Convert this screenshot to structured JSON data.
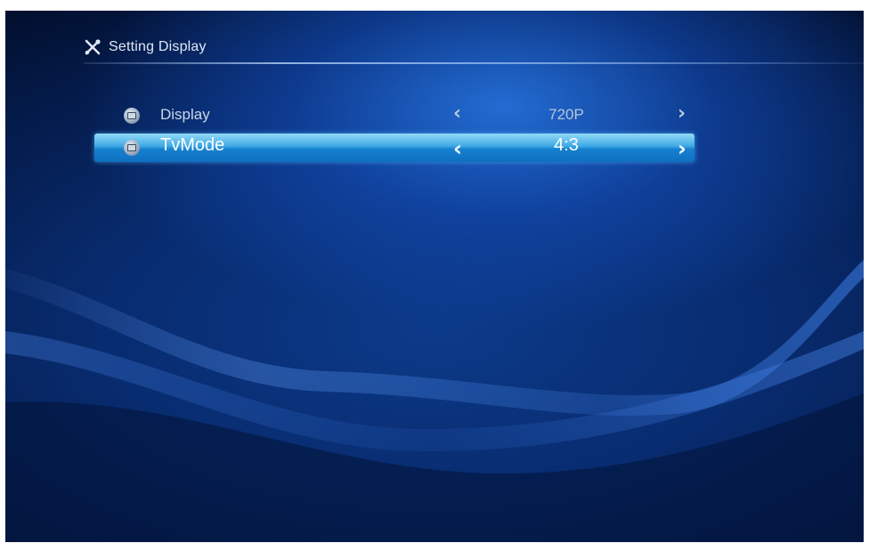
{
  "header": {
    "title": "Setting Display",
    "icon": "tools-icon"
  },
  "settings": [
    {
      "label": "Display",
      "value": "720P",
      "icon": "monitor-icon",
      "selected": false
    },
    {
      "label": "TvMode",
      "value": "4:3",
      "icon": "tv-icon",
      "selected": true
    }
  ],
  "arrows": {
    "left": "‹",
    "right": "›"
  },
  "colors": {
    "background": "#0a2f78",
    "highlight": "#2ba0e3",
    "text": "#c9d6e8",
    "selected_text": "#ffffff"
  }
}
